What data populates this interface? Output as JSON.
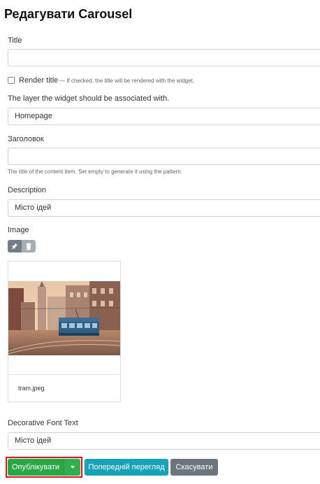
{
  "page": {
    "title": "Редагувати Carousel"
  },
  "form": {
    "title_label": "Title",
    "title_value": "",
    "render_title_label": "Render title",
    "render_title_checked": false,
    "render_title_hint": "— If checked, the title will be rendered with the widget.",
    "layer_label": "The layer the widget should be associated with.",
    "layer_value": "Homepage",
    "heading_label": "Заголовок",
    "heading_value": "",
    "heading_hint": "The title of the content item. Set empty to generate it using the pattern.",
    "description_label": "Description",
    "description_value": "Місто ідей",
    "image_label": "Image",
    "image_filename": "tram.jpeg",
    "decorative_label": "Decorative Font Text",
    "decorative_value": "Місто ідей"
  },
  "icons": {
    "pin": "pin-icon",
    "trash": "trash-icon",
    "caret": "caret-down-icon"
  },
  "actions": {
    "publish_label": "Опублікувати",
    "preview_label": "Попередній перегляд",
    "cancel_label": "Скасувати"
  },
  "colors": {
    "publish": "#28a745",
    "preview": "#17a2b8",
    "cancel": "#6c757d",
    "highlight": "#e0151c"
  }
}
